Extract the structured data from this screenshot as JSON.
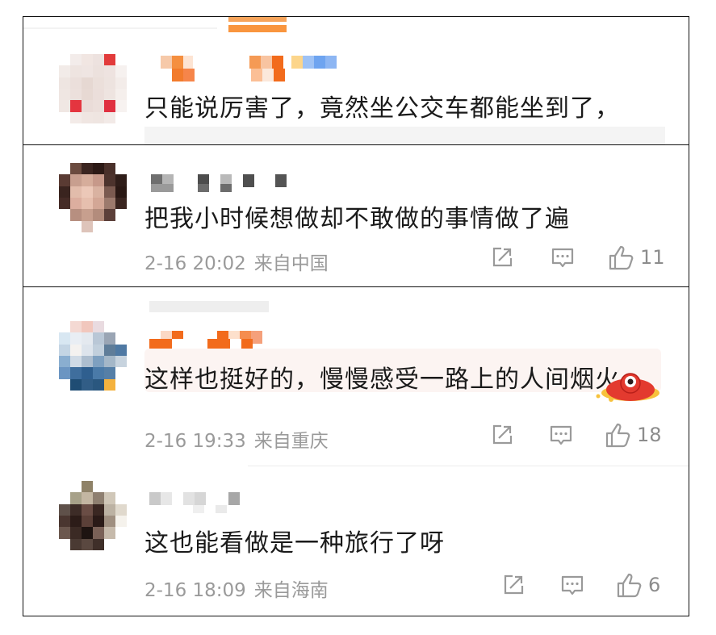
{
  "colors": {
    "meta": "#9a9a9a",
    "text": "#1a1a1a",
    "icon": "#9a9a9a",
    "accent": "#f26b1c"
  },
  "comments": [
    {
      "text": "只能说厉害了，竟然坐公交车都能坐到了，"
    },
    {
      "text": "把我小时候想做却不敢做的事情做了遍",
      "date": "2-16 20:02",
      "source": "来自中国",
      "likes": "11"
    },
    {
      "text": "这样也挺好的，慢慢感受一路上的人间烟火",
      "date": "2-16 19:33",
      "source": "来自重庆",
      "likes": "18"
    },
    {
      "text": "这也能看做是一种旅行了呀",
      "date": "2-16 18:09",
      "source": "来自海南",
      "likes": "6"
    }
  ]
}
